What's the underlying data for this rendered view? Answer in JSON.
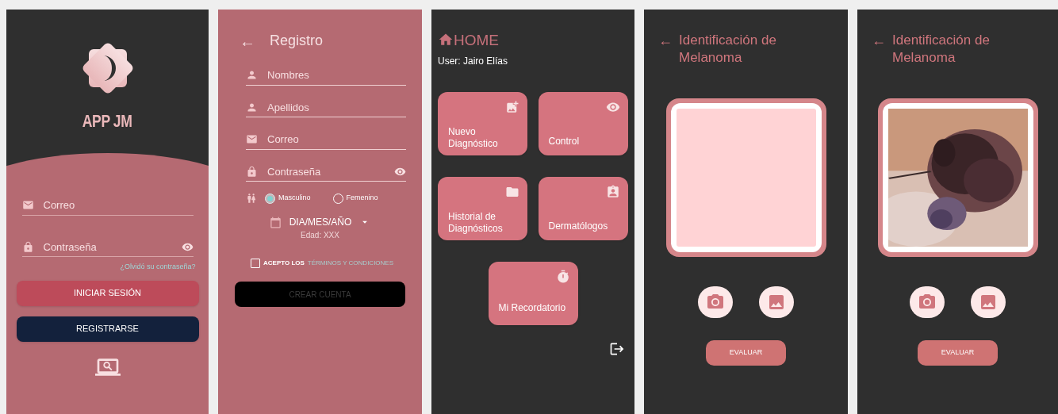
{
  "login": {
    "app_name": "APP JM",
    "fields": [
      {
        "kind": "email",
        "placeholder": "Correo",
        "reveal": false
      },
      {
        "kind": "password",
        "placeholder": "Contraseña",
        "reveal": true
      }
    ],
    "forgot_link": "¿Olvidó su contraseña?",
    "buttons": [
      {
        "label": "INICIAR SESIÓN",
        "kind": "primary"
      },
      {
        "label": "REGISTRARSE",
        "kind": "secondary"
      }
    ]
  },
  "register": {
    "back": "←",
    "title": "Registro",
    "fields": [
      {
        "kind": "person",
        "placeholder": "Nombres",
        "reveal": false
      },
      {
        "kind": "person",
        "placeholder": "Apellidos",
        "reveal": false
      },
      {
        "kind": "email",
        "placeholder": "Correo",
        "reveal": false
      },
      {
        "kind": "password",
        "placeholder": "Contraseña",
        "reveal": true
      }
    ],
    "gender": [
      {
        "label": "Masculino",
        "selected": true
      },
      {
        "label": "Femenino",
        "selected": false
      }
    ],
    "date": "DIA/MES/AÑO",
    "age": "Edad: XXX",
    "terms": {
      "checked": false,
      "text": "ACEPTO LOS",
      "link": "TÉRMINOS Y CONDICIONES"
    },
    "submit": {
      "label": "CREAR CUENTA",
      "disabled": true
    }
  },
  "home": {
    "title": "HOME",
    "user": "User: Jairo Elías",
    "tiles": [
      {
        "label": "Nuevo Diagnóstico"
      },
      {
        "label": "Control"
      },
      {
        "label": "Historial de Diagnósticos"
      },
      {
        "label": "Dermatólogos"
      },
      {
        "label": "Mi Recordatorio"
      }
    ]
  },
  "identify": [
    {
      "back": "←",
      "title": "Identificación de Melanoma",
      "image": {
        "kind": "empty"
      },
      "button": "EVALUAR"
    },
    {
      "back": "←",
      "title": "Identificación de Melanoma",
      "button": "EVALUAR"
    }
  ]
}
